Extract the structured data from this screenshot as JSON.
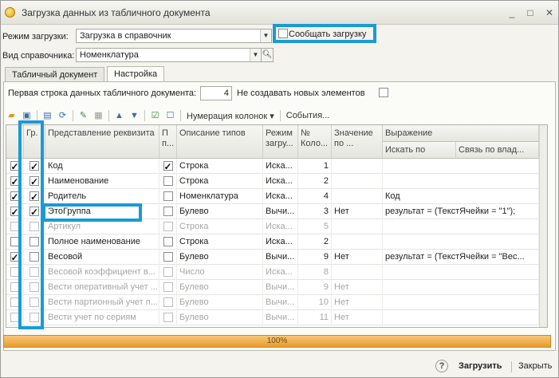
{
  "window": {
    "title": "Загрузка данных из табличного документа"
  },
  "form": {
    "load_mode_label": "Режим загрузки:",
    "load_mode_value": "Загрузка в справочник",
    "report_load_label": "Сообщать загрузку",
    "catalog_kind_label": "Вид справочника:",
    "catalog_kind_value": "Номенклатура"
  },
  "tabs": [
    {
      "label": "Табличный документ",
      "active": false
    },
    {
      "label": "Настройка",
      "active": true
    }
  ],
  "settings": {
    "first_row_label": "Первая строка данных табличного документа:",
    "first_row_value": "4",
    "no_new_label": "Не создавать новых элементов"
  },
  "toolbar": {
    "numbering_label": "Нумерация колонок",
    "events_label": "События..."
  },
  "grid": {
    "headers": {
      "group": "Гр.",
      "representation": "Представление реквизита",
      "p": "П п...",
      "types": "Описание типов",
      "mode": "Режим загру...",
      "number": "№ Коло...",
      "value": "Значение по ...",
      "expression": "Выражение",
      "search_by": "Искать по",
      "link_by": "Связь по влад..."
    },
    "rows": [
      {
        "load": true,
        "group": true,
        "name": "Код",
        "p": true,
        "type": "Строка",
        "mode": "Иска...",
        "col": "1",
        "value": "",
        "expr": "",
        "dim": false
      },
      {
        "load": true,
        "group": true,
        "name": "Наименование",
        "p": false,
        "type": "Строка",
        "mode": "Иска...",
        "col": "2",
        "value": "",
        "expr": "",
        "dim": false
      },
      {
        "load": true,
        "group": true,
        "name": "Родитель",
        "p": false,
        "type": "Номенклатура",
        "mode": "Иска...",
        "col": "4",
        "value": "",
        "expr": "Код",
        "dim": false
      },
      {
        "load": true,
        "group": true,
        "name": "ЭтоГруппа",
        "p": false,
        "type": "Булево",
        "mode": "Вычи...",
        "col": "3",
        "value": "Нет",
        "expr": "результат = (ТекстЯчейки = \"1\");",
        "dim": false
      },
      {
        "load": false,
        "group": false,
        "name": "Артикул",
        "p": false,
        "type": "Строка",
        "mode": "Иска...",
        "col": "5",
        "value": "",
        "expr": "",
        "dim": true
      },
      {
        "load": false,
        "group": false,
        "name": "Полное наименование",
        "p": false,
        "type": "Строка",
        "mode": "Иска...",
        "col": "2",
        "value": "",
        "expr": "",
        "dim": false
      },
      {
        "load": true,
        "group": false,
        "name": "Весовой",
        "p": false,
        "type": "Булево",
        "mode": "Вычи...",
        "col": "9",
        "value": "Нет",
        "expr": "результат = (ТекстЯчейки = \"Вес...",
        "dim": false
      },
      {
        "load": false,
        "group": false,
        "name": "Весовой коэффициент в...",
        "p": false,
        "type": "Число",
        "mode": "Иска...",
        "col": "8",
        "value": "",
        "expr": "",
        "dim": true
      },
      {
        "load": false,
        "group": false,
        "name": "Вести оперативный учет ...",
        "p": false,
        "type": "Булево",
        "mode": "Вычи...",
        "col": "9",
        "value": "Нет",
        "expr": "",
        "dim": true
      },
      {
        "load": false,
        "group": false,
        "name": "Вести партионный учет п...",
        "p": false,
        "type": "Булево",
        "mode": "Вычи...",
        "col": "10",
        "value": "Нет",
        "expr": "",
        "dim": true
      },
      {
        "load": false,
        "group": false,
        "name": "Вести учет по сериям",
        "p": false,
        "type": "Булево",
        "mode": "Вычи...",
        "col": "11",
        "value": "Нет",
        "expr": "",
        "dim": true
      }
    ]
  },
  "progress": {
    "label": "100%",
    "value": 100
  },
  "buttons": {
    "help": "?",
    "load": "Загрузить",
    "close": "Закрыть"
  }
}
